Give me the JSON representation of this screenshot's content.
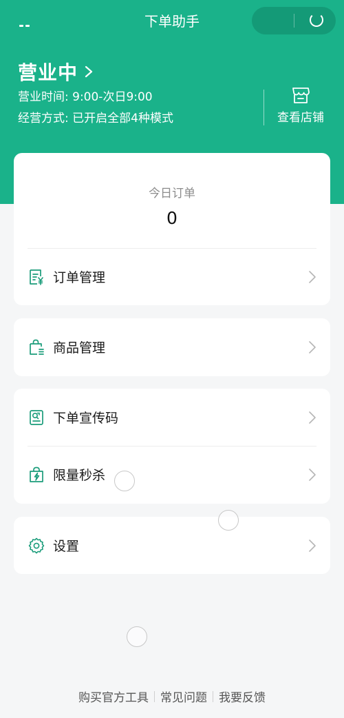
{
  "nav": {
    "title": "下单助手"
  },
  "store": {
    "status": "营业中",
    "hours": "营业时间: 9:00-次日9:00",
    "mode": "经营方式: 已开启全部4种模式",
    "view_store_label": "查看店铺"
  },
  "today": {
    "label": "今日订单",
    "value": "0"
  },
  "menu": {
    "order_management": "订单管理",
    "product_management": "商品管理",
    "promo_code": "下单宣传码",
    "flash_sale": "限量秒杀",
    "settings": "设置"
  },
  "footer": {
    "links": [
      "购买官方工具",
      "常见问题",
      "我要反馈"
    ]
  },
  "colors": {
    "accent": "#1ab28a",
    "icon": "#1a9c7a"
  },
  "icons": {
    "store": "store-icon",
    "order": "order-list-icon",
    "product": "shopping-bag-icon",
    "promo": "qr-poster-icon",
    "flash": "lightning-bag-icon",
    "settings": "gear-icon",
    "chevron": "chevron-right-icon"
  }
}
